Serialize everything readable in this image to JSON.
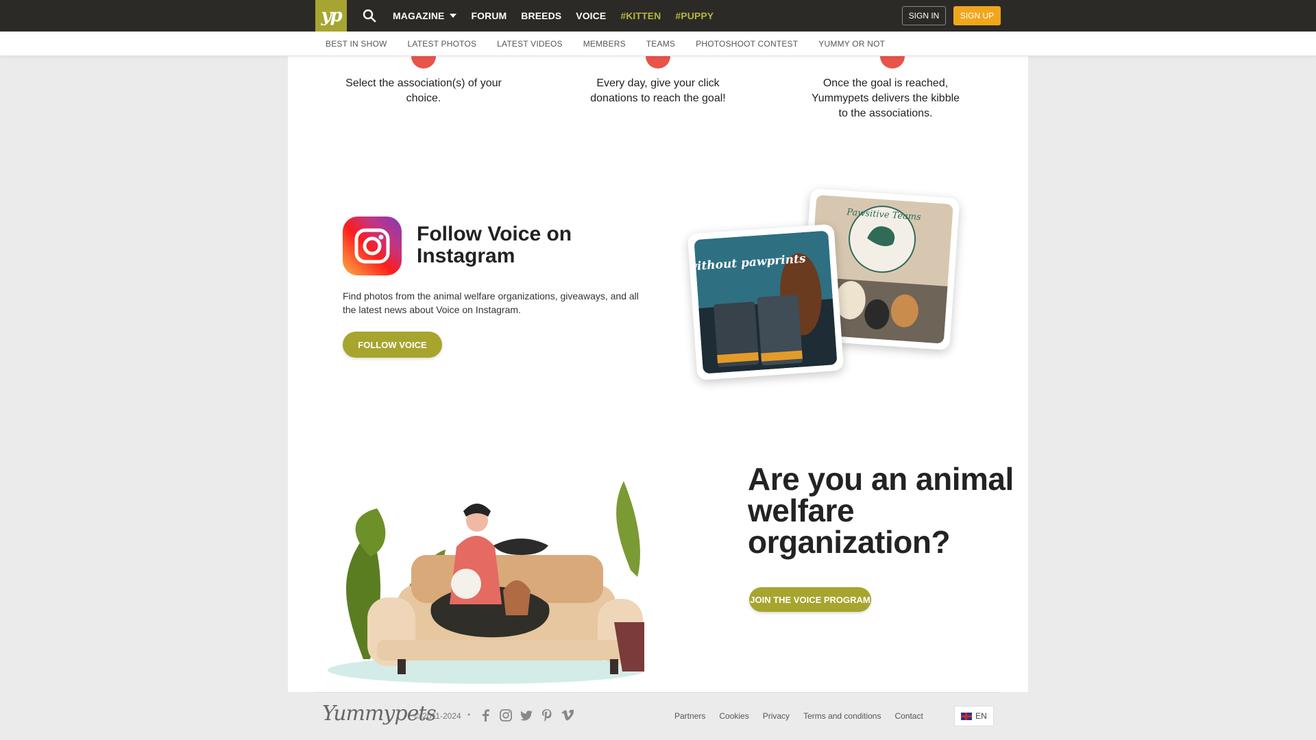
{
  "topnav": {
    "logo_text": "yp",
    "items": [
      {
        "label": "MAGAZINE",
        "has_dropdown": true
      },
      {
        "label": "FORUM"
      },
      {
        "label": "BREEDS"
      },
      {
        "label": "VOICE"
      },
      {
        "label": "#KITTEN",
        "accent": true
      },
      {
        "label": "#PUPPY",
        "accent": true
      }
    ],
    "signin_label": "SIGN IN",
    "signup_label": "SIGN UP"
  },
  "subnav": {
    "items": [
      "BEST IN SHOW",
      "LATEST PHOTOS",
      "LATEST VIDEOS",
      "MEMBERS",
      "TEAMS",
      "PHOTOSHOOT CONTEST",
      "YUMMY OR NOT"
    ]
  },
  "steps": [
    {
      "text": "Select the association(s) of your choice."
    },
    {
      "text": "Every day, give your click donations to reach the goal!"
    },
    {
      "text": "Once the goal is reached, Yummypets delivers the kibble to the associations."
    }
  ],
  "instagram": {
    "title": "Follow Voice on Instagram",
    "description": "Find photos from the animal welfare organizations, giveaways, and all the latest news about Voice on Instagram.",
    "button_label": "FOLLOW VOICE",
    "photo1_text": "without pawprints",
    "photo2_text": "Pawsitive Teams"
  },
  "organization": {
    "title": "Are you an animal welfare organization?",
    "button_label": "JOIN THE VOICE PROGRAM"
  },
  "footer": {
    "logo_text": "Yummypets",
    "copyright": "© 2011-2024",
    "separator": "•",
    "social_icons": [
      "facebook-icon",
      "instagram-icon",
      "twitter-icon",
      "pinterest-icon",
      "vimeo-icon"
    ],
    "links": [
      "Partners",
      "Cookies",
      "Privacy",
      "Terms and conditions",
      "Contact"
    ],
    "language": "EN"
  },
  "colors": {
    "topbar": "#2b2a27",
    "brand_olive": "#a7a52e",
    "signup_orange": "#f0a61d",
    "step_red": "#e8534a"
  }
}
